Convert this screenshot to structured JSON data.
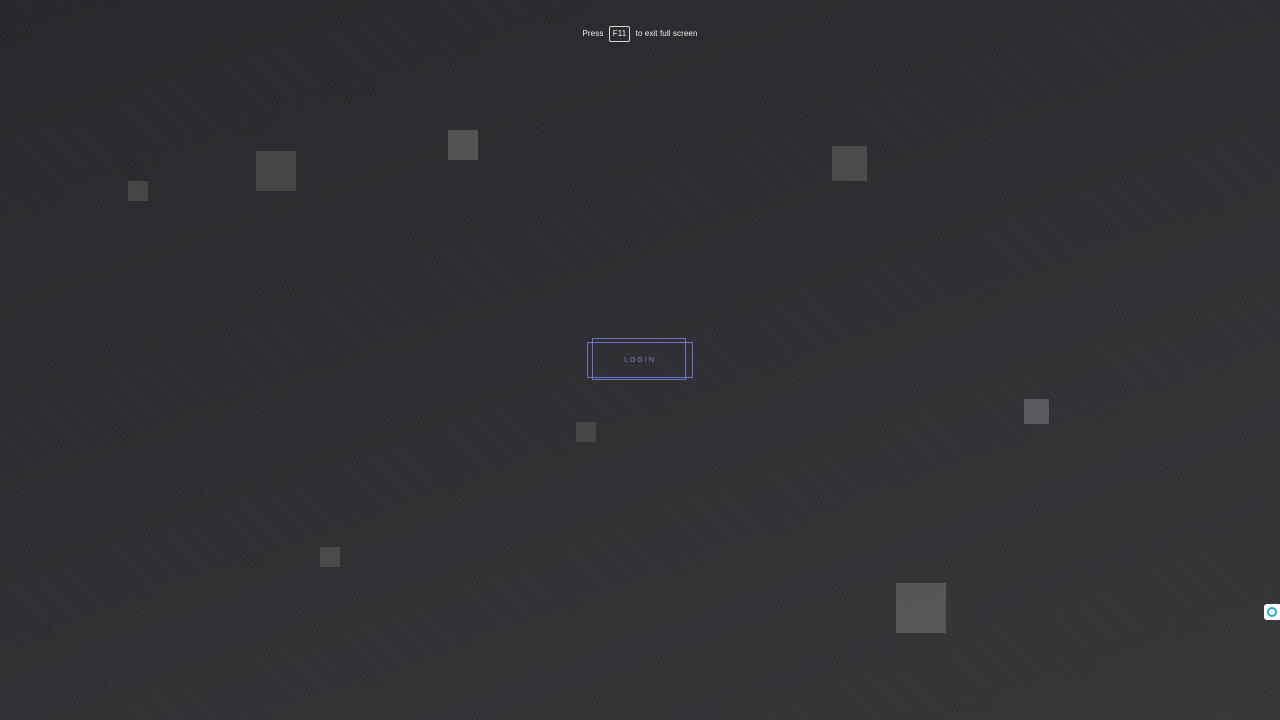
{
  "fullscreen_hint": {
    "prefix": "Press",
    "key": "F11",
    "suffix": "to exit full screen"
  },
  "login": {
    "label": "LOGIN"
  },
  "colors": {
    "background": "#2c2e31",
    "accent": "#6c75c9",
    "square": "#5a5b5d",
    "widget_ring": "#29a8e0"
  },
  "icons": {
    "side_widget": "circle-icon"
  }
}
